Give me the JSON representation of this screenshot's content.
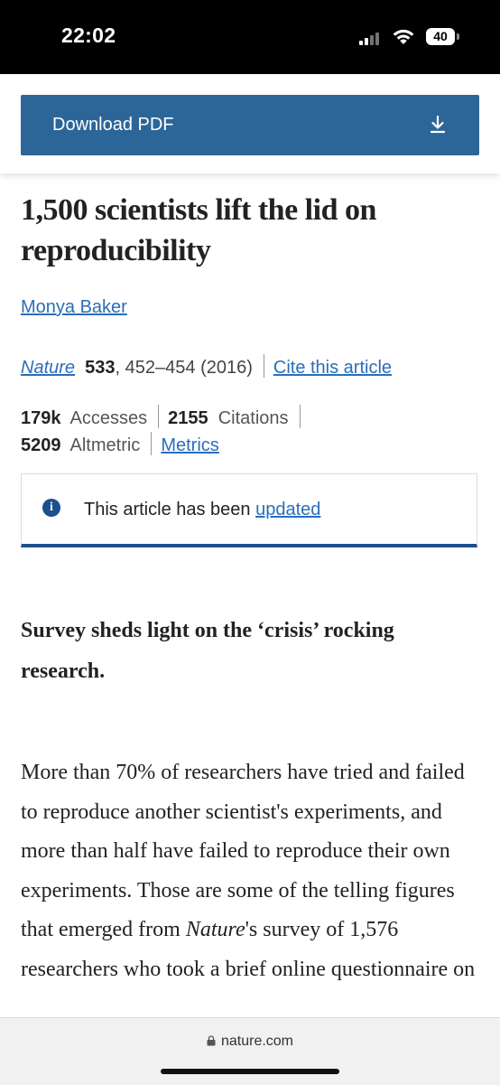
{
  "status_bar": {
    "time": "22:02",
    "battery": "40"
  },
  "header": {
    "download_label": "Download PDF",
    "download_icon": "download-icon"
  },
  "article": {
    "title": "1,500 scientists lift the lid on reproducibility",
    "author": "Monya Baker",
    "journal": "Nature",
    "volume": "533",
    "pages_year": ", 452–454 (2016)",
    "cite_label": "Cite this article",
    "metrics": {
      "accesses_value": "179k",
      "accesses_label": "Accesses",
      "citations_value": "2155",
      "citations_label": "Citations",
      "altmetric_value": "5209",
      "altmetric_label": "Altmetric",
      "metrics_link": "Metrics"
    },
    "update_notice": {
      "text": "This article has been",
      "link": "updated"
    },
    "standfirst": "Survey sheds light on the ‘crisis’ rocking research.",
    "body_part1": "More than 70% of researchers have tried and failed to reproduce another scientist's experiments, and more than half have failed to reproduce their own experiments. Those are some of the telling figures that emerged from ",
    "body_em": "Nature",
    "body_part2": "'s survey of 1,576 researchers who took a brief online questionnaire on"
  },
  "browser": {
    "url": "nature.com"
  },
  "colors": {
    "accent": "#2c6699",
    "link": "#2a6ebb",
    "update_border": "#1e4e8c"
  }
}
